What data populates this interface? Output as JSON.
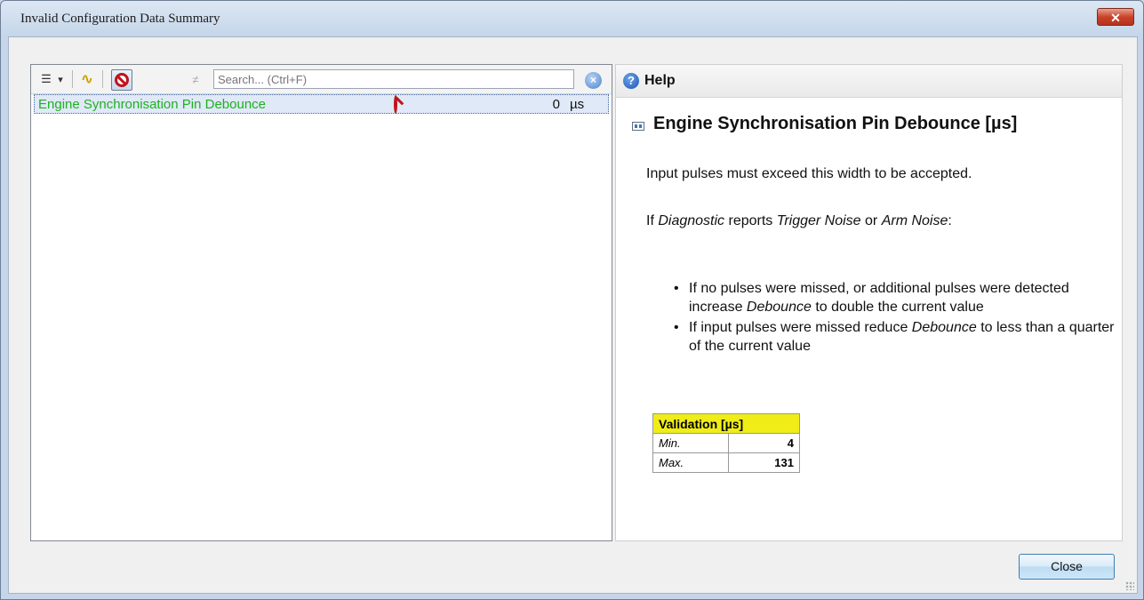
{
  "window": {
    "title": "Invalid Configuration Data Summary",
    "close_glyph": "✕"
  },
  "toolbar": {
    "list_glyph": "☰",
    "dropdown_glyph": "▾",
    "wave_glyph": "∿",
    "notequal_glyph": "≠",
    "search_placeholder": "Search... (Ctrl+F)",
    "clear_glyph": "×"
  },
  "list": {
    "rows": [
      {
        "name": "Engine Synchronisation Pin Debounce",
        "value": "0",
        "unit": "µs",
        "status": "invalid"
      }
    ]
  },
  "help": {
    "header": "Help",
    "header_glyph": "?",
    "param_title": "Engine Synchronisation Pin Debounce [µs]",
    "p1": "Input pulses must exceed this width to be accepted.",
    "p2_parts": [
      "If ",
      "Diagnostic",
      " reports ",
      "Trigger Noise",
      " or ",
      "Arm Noise",
      ":"
    ],
    "bullet1_parts": [
      "If no pulses were missed, or additional pulses were detected increase ",
      "Debounce",
      " to double the current value"
    ],
    "bullet2_parts": [
      "If input pulses were missed reduce ",
      "Debounce",
      " to less than a quarter of the current value"
    ],
    "validation": {
      "header": "Validation [µs]",
      "rows": [
        {
          "label": "Min.",
          "value": "4"
        },
        {
          "label": "Max.",
          "value": "131"
        }
      ]
    }
  },
  "footer": {
    "close_label": "Close"
  },
  "colors": {
    "invalid_text": "#20b020",
    "validation_header": "#f0ec18",
    "accent": "#3c7fb1"
  }
}
